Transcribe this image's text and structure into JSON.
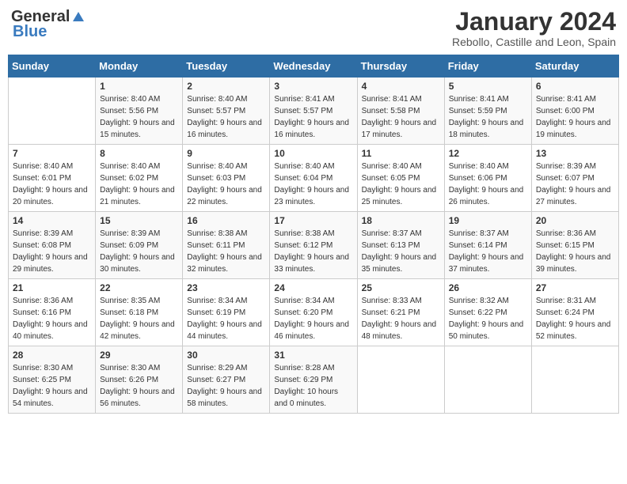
{
  "logo": {
    "general": "General",
    "blue": "Blue"
  },
  "title": "January 2024",
  "subtitle": "Rebollo, Castille and Leon, Spain",
  "days_header": [
    "Sunday",
    "Monday",
    "Tuesday",
    "Wednesday",
    "Thursday",
    "Friday",
    "Saturday"
  ],
  "weeks": [
    [
      {
        "day": "",
        "sunrise": "",
        "sunset": "",
        "daylight": ""
      },
      {
        "day": "1",
        "sunrise": "Sunrise: 8:40 AM",
        "sunset": "Sunset: 5:56 PM",
        "daylight": "Daylight: 9 hours and 15 minutes."
      },
      {
        "day": "2",
        "sunrise": "Sunrise: 8:40 AM",
        "sunset": "Sunset: 5:57 PM",
        "daylight": "Daylight: 9 hours and 16 minutes."
      },
      {
        "day": "3",
        "sunrise": "Sunrise: 8:41 AM",
        "sunset": "Sunset: 5:57 PM",
        "daylight": "Daylight: 9 hours and 16 minutes."
      },
      {
        "day": "4",
        "sunrise": "Sunrise: 8:41 AM",
        "sunset": "Sunset: 5:58 PM",
        "daylight": "Daylight: 9 hours and 17 minutes."
      },
      {
        "day": "5",
        "sunrise": "Sunrise: 8:41 AM",
        "sunset": "Sunset: 5:59 PM",
        "daylight": "Daylight: 9 hours and 18 minutes."
      },
      {
        "day": "6",
        "sunrise": "Sunrise: 8:41 AM",
        "sunset": "Sunset: 6:00 PM",
        "daylight": "Daylight: 9 hours and 19 minutes."
      }
    ],
    [
      {
        "day": "7",
        "sunrise": "Sunrise: 8:40 AM",
        "sunset": "Sunset: 6:01 PM",
        "daylight": "Daylight: 9 hours and 20 minutes."
      },
      {
        "day": "8",
        "sunrise": "Sunrise: 8:40 AM",
        "sunset": "Sunset: 6:02 PM",
        "daylight": "Daylight: 9 hours and 21 minutes."
      },
      {
        "day": "9",
        "sunrise": "Sunrise: 8:40 AM",
        "sunset": "Sunset: 6:03 PM",
        "daylight": "Daylight: 9 hours and 22 minutes."
      },
      {
        "day": "10",
        "sunrise": "Sunrise: 8:40 AM",
        "sunset": "Sunset: 6:04 PM",
        "daylight": "Daylight: 9 hours and 23 minutes."
      },
      {
        "day": "11",
        "sunrise": "Sunrise: 8:40 AM",
        "sunset": "Sunset: 6:05 PM",
        "daylight": "Daylight: 9 hours and 25 minutes."
      },
      {
        "day": "12",
        "sunrise": "Sunrise: 8:40 AM",
        "sunset": "Sunset: 6:06 PM",
        "daylight": "Daylight: 9 hours and 26 minutes."
      },
      {
        "day": "13",
        "sunrise": "Sunrise: 8:39 AM",
        "sunset": "Sunset: 6:07 PM",
        "daylight": "Daylight: 9 hours and 27 minutes."
      }
    ],
    [
      {
        "day": "14",
        "sunrise": "Sunrise: 8:39 AM",
        "sunset": "Sunset: 6:08 PM",
        "daylight": "Daylight: 9 hours and 29 minutes."
      },
      {
        "day": "15",
        "sunrise": "Sunrise: 8:39 AM",
        "sunset": "Sunset: 6:09 PM",
        "daylight": "Daylight: 9 hours and 30 minutes."
      },
      {
        "day": "16",
        "sunrise": "Sunrise: 8:38 AM",
        "sunset": "Sunset: 6:11 PM",
        "daylight": "Daylight: 9 hours and 32 minutes."
      },
      {
        "day": "17",
        "sunrise": "Sunrise: 8:38 AM",
        "sunset": "Sunset: 6:12 PM",
        "daylight": "Daylight: 9 hours and 33 minutes."
      },
      {
        "day": "18",
        "sunrise": "Sunrise: 8:37 AM",
        "sunset": "Sunset: 6:13 PM",
        "daylight": "Daylight: 9 hours and 35 minutes."
      },
      {
        "day": "19",
        "sunrise": "Sunrise: 8:37 AM",
        "sunset": "Sunset: 6:14 PM",
        "daylight": "Daylight: 9 hours and 37 minutes."
      },
      {
        "day": "20",
        "sunrise": "Sunrise: 8:36 AM",
        "sunset": "Sunset: 6:15 PM",
        "daylight": "Daylight: 9 hours and 39 minutes."
      }
    ],
    [
      {
        "day": "21",
        "sunrise": "Sunrise: 8:36 AM",
        "sunset": "Sunset: 6:16 PM",
        "daylight": "Daylight: 9 hours and 40 minutes."
      },
      {
        "day": "22",
        "sunrise": "Sunrise: 8:35 AM",
        "sunset": "Sunset: 6:18 PM",
        "daylight": "Daylight: 9 hours and 42 minutes."
      },
      {
        "day": "23",
        "sunrise": "Sunrise: 8:34 AM",
        "sunset": "Sunset: 6:19 PM",
        "daylight": "Daylight: 9 hours and 44 minutes."
      },
      {
        "day": "24",
        "sunrise": "Sunrise: 8:34 AM",
        "sunset": "Sunset: 6:20 PM",
        "daylight": "Daylight: 9 hours and 46 minutes."
      },
      {
        "day": "25",
        "sunrise": "Sunrise: 8:33 AM",
        "sunset": "Sunset: 6:21 PM",
        "daylight": "Daylight: 9 hours and 48 minutes."
      },
      {
        "day": "26",
        "sunrise": "Sunrise: 8:32 AM",
        "sunset": "Sunset: 6:22 PM",
        "daylight": "Daylight: 9 hours and 50 minutes."
      },
      {
        "day": "27",
        "sunrise": "Sunrise: 8:31 AM",
        "sunset": "Sunset: 6:24 PM",
        "daylight": "Daylight: 9 hours and 52 minutes."
      }
    ],
    [
      {
        "day": "28",
        "sunrise": "Sunrise: 8:30 AM",
        "sunset": "Sunset: 6:25 PM",
        "daylight": "Daylight: 9 hours and 54 minutes."
      },
      {
        "day": "29",
        "sunrise": "Sunrise: 8:30 AM",
        "sunset": "Sunset: 6:26 PM",
        "daylight": "Daylight: 9 hours and 56 minutes."
      },
      {
        "day": "30",
        "sunrise": "Sunrise: 8:29 AM",
        "sunset": "Sunset: 6:27 PM",
        "daylight": "Daylight: 9 hours and 58 minutes."
      },
      {
        "day": "31",
        "sunrise": "Sunrise: 8:28 AM",
        "sunset": "Sunset: 6:29 PM",
        "daylight": "Daylight: 10 hours and 0 minutes."
      },
      {
        "day": "",
        "sunrise": "",
        "sunset": "",
        "daylight": ""
      },
      {
        "day": "",
        "sunrise": "",
        "sunset": "",
        "daylight": ""
      },
      {
        "day": "",
        "sunrise": "",
        "sunset": "",
        "daylight": ""
      }
    ]
  ]
}
